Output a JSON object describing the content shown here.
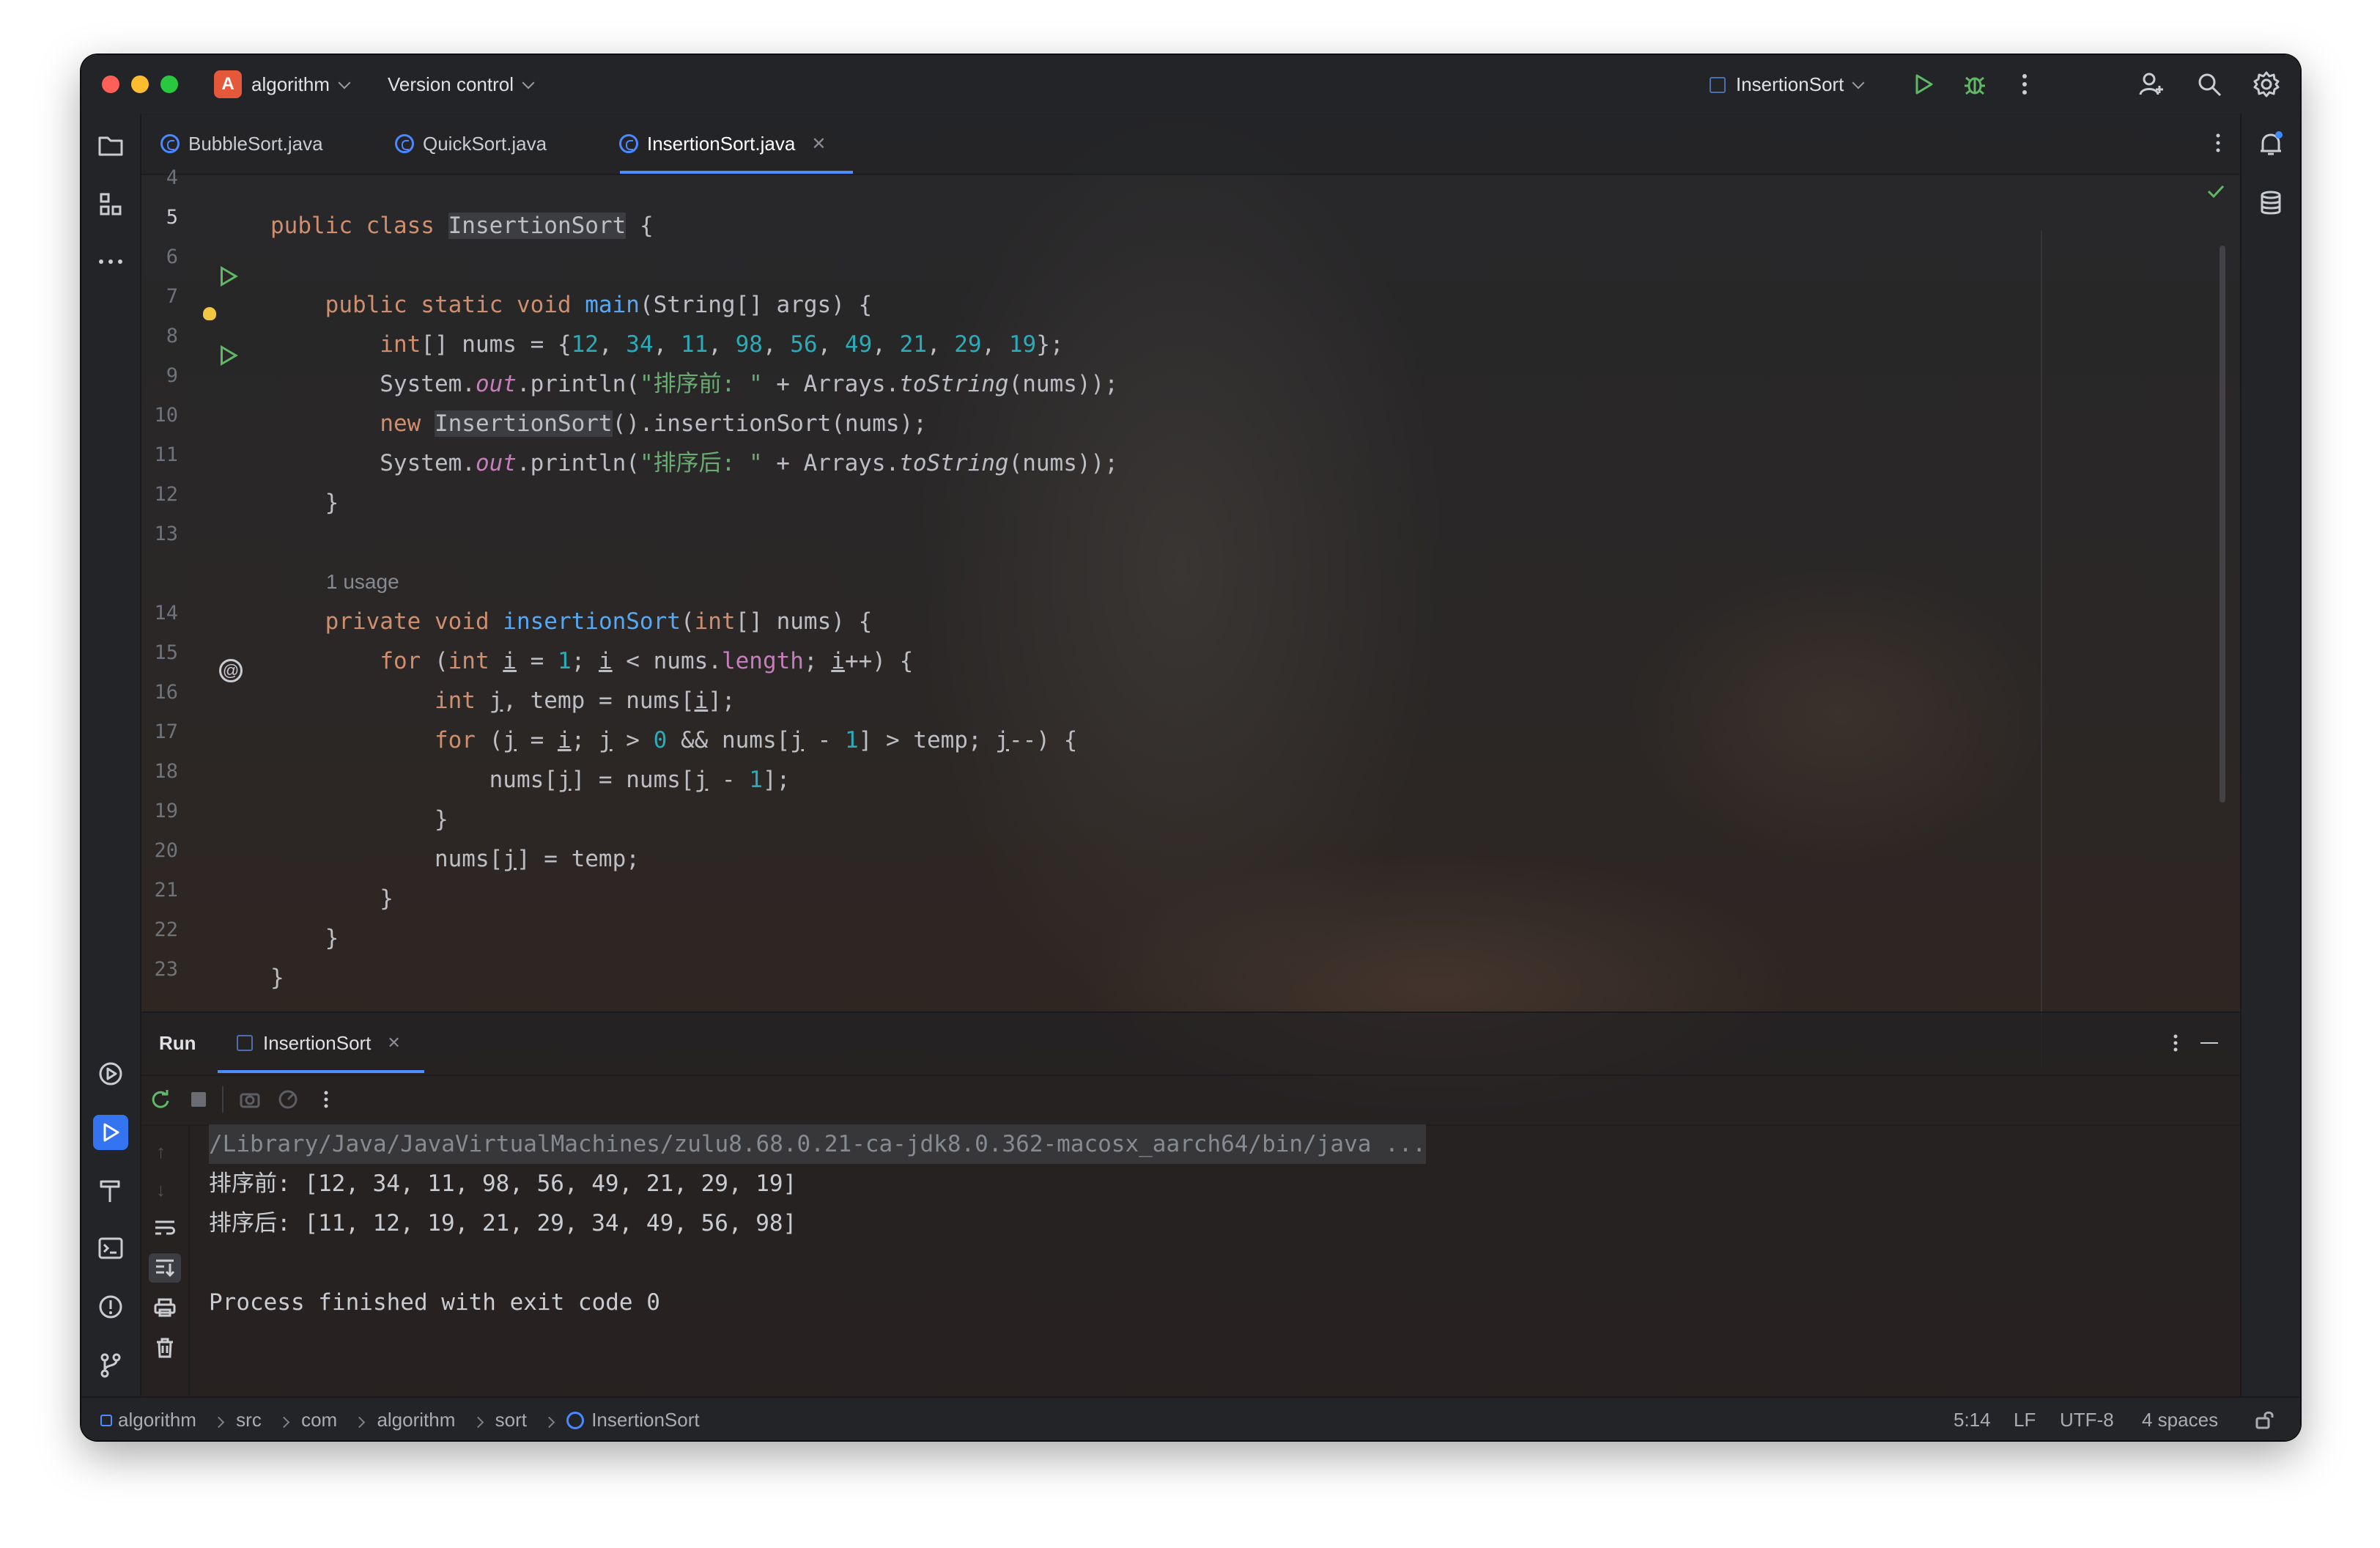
{
  "titlebar": {
    "project_initial": "A",
    "project_name": "algorithm",
    "vcs_label": "Version control",
    "run_config": "InsertionSort"
  },
  "tabs": [
    {
      "label": "BubbleSort.java",
      "active": false
    },
    {
      "label": "QuickSort.java",
      "active": false
    },
    {
      "label": "InsertionSort.java",
      "active": true
    }
  ],
  "editor": {
    "line_numbers": [
      "4",
      "5",
      "6",
      "7",
      "8",
      "9",
      "10",
      "11",
      "12",
      "13",
      "14",
      "15",
      "16",
      "17",
      "18",
      "19",
      "20",
      "21",
      "22",
      "23"
    ],
    "usage_hint": "1 usage",
    "string_before": "\"排序前: \"",
    "string_after": "\"排序后: \""
  },
  "run_panel": {
    "title": "Run",
    "config_tab": "InsertionSort",
    "output": {
      "java_path": "/Library/Java/JavaVirtualMachines/zulu8.68.0.21-ca-jdk8.0.362-macosx_aarch64/bin/java ...",
      "before": "排序前: [12, 34, 11, 98, 56, 49, 21, 29, 19]",
      "after": "排序后: [11, 12, 19, 21, 29, 34, 49, 56, 98]",
      "finished": "Process finished with exit code 0"
    }
  },
  "statusbar": {
    "breadcrumbs": [
      "algorithm",
      "src",
      "com",
      "algorithm",
      "sort",
      "InsertionSort"
    ],
    "position": "5:14",
    "line_ending": "LF",
    "encoding": "UTF-8",
    "indent": "4 spaces"
  },
  "colors": {
    "accent": "#4d8dff",
    "keyword": "#cf8e6d",
    "method": "#56a8f5",
    "number": "#2aacb8",
    "string": "#6aab73",
    "run_green": "#5fb865"
  }
}
